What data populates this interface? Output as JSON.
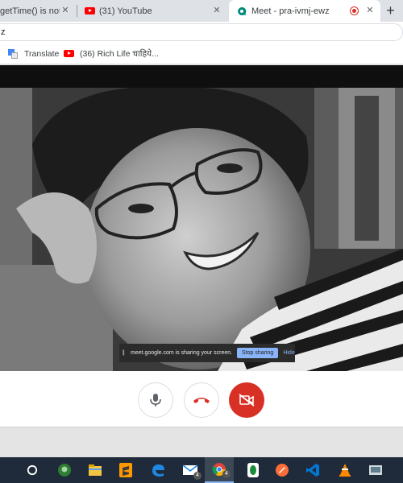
{
  "browser": {
    "tabs": [
      {
        "title": "getTime() is not a",
        "close": "✕"
      },
      {
        "title": "(31) YouTube",
        "close": "✕"
      },
      {
        "title": "Meet - pra-ivmj-ewz",
        "close": "✕"
      }
    ],
    "new_tab": "+",
    "address": "z",
    "bookmarks": [
      {
        "label": "Translate"
      },
      {
        "label": "(36) Rich Life चाहिये..."
      }
    ]
  },
  "meet": {
    "share_notice": {
      "grip": "||",
      "message": "meet.google.com is sharing your screen.",
      "stop_label": "Stop sharing",
      "hide_label": "Hide"
    },
    "controls": {
      "mic_icon": "microphone-icon",
      "hangup_icon": "phone-hangup-icon",
      "camera_icon": "camera-off-icon"
    },
    "colors": {
      "hangup": "#d93025",
      "camera_off_bg": "#d93025",
      "stop_sharing": "#8ab4f8"
    }
  },
  "taskbar": {
    "chrome_badge": "4",
    "mail_badge": "4",
    "icons": [
      "cortana-icon",
      "assistant-icon",
      "file-explorer-icon",
      "sublime-text-icon",
      "edge-icon",
      "mail-icon",
      "chrome-icon",
      "whatsapp-icon",
      "postman-icon",
      "vscode-icon",
      "vlc-icon",
      "media-icon"
    ]
  }
}
